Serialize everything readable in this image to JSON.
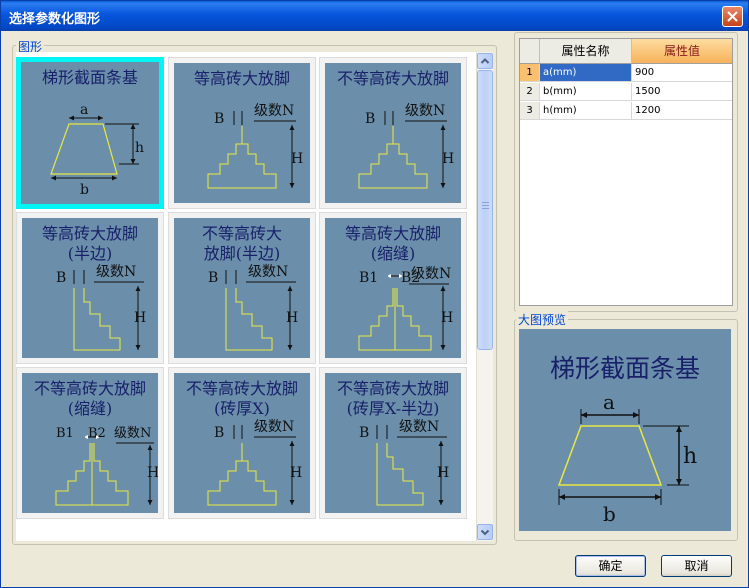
{
  "window": {
    "title": "选择参数化图形"
  },
  "gallery": {
    "group_label": "图形",
    "tiles": [
      {
        "title": "梯形截面条基",
        "selected": true
      },
      {
        "title": "等高砖大放脚"
      },
      {
        "title": "不等高砖大放脚"
      },
      {
        "title": "等高砖大放脚\n(半边)"
      },
      {
        "title": "不等高砖大\n放脚(半边)"
      },
      {
        "title": "等高砖大放脚\n(缩缝)"
      },
      {
        "title": "不等高砖大放脚\n(缩缝)"
      },
      {
        "title": "不等高砖大放脚\n(砖厚X)"
      },
      {
        "title": "不等高砖大放脚\n(砖厚X-半边)"
      }
    ],
    "labels": {
      "a": "a",
      "b": "b",
      "h": "h",
      "B": "B",
      "N": "级数N",
      "H": "H",
      "B1": "B1",
      "B2": "B2"
    }
  },
  "properties": {
    "col_name": "属性名称",
    "col_value": "属性值",
    "rows": [
      {
        "num": "1",
        "name": "a(mm)",
        "value": "900"
      },
      {
        "num": "2",
        "name": "b(mm)",
        "value": "1500"
      },
      {
        "num": "3",
        "name": "h(mm)",
        "value": "1200"
      }
    ]
  },
  "preview": {
    "group_label": "大图预览",
    "title": "梯形截面条基",
    "a": "a",
    "b": "b",
    "h": "h"
  },
  "buttons": {
    "ok": "确定",
    "cancel": "取消"
  },
  "colors": {
    "tile_bg": "#6b8faa",
    "selection": "#00f5f5",
    "figure_line": "#e8e840"
  }
}
